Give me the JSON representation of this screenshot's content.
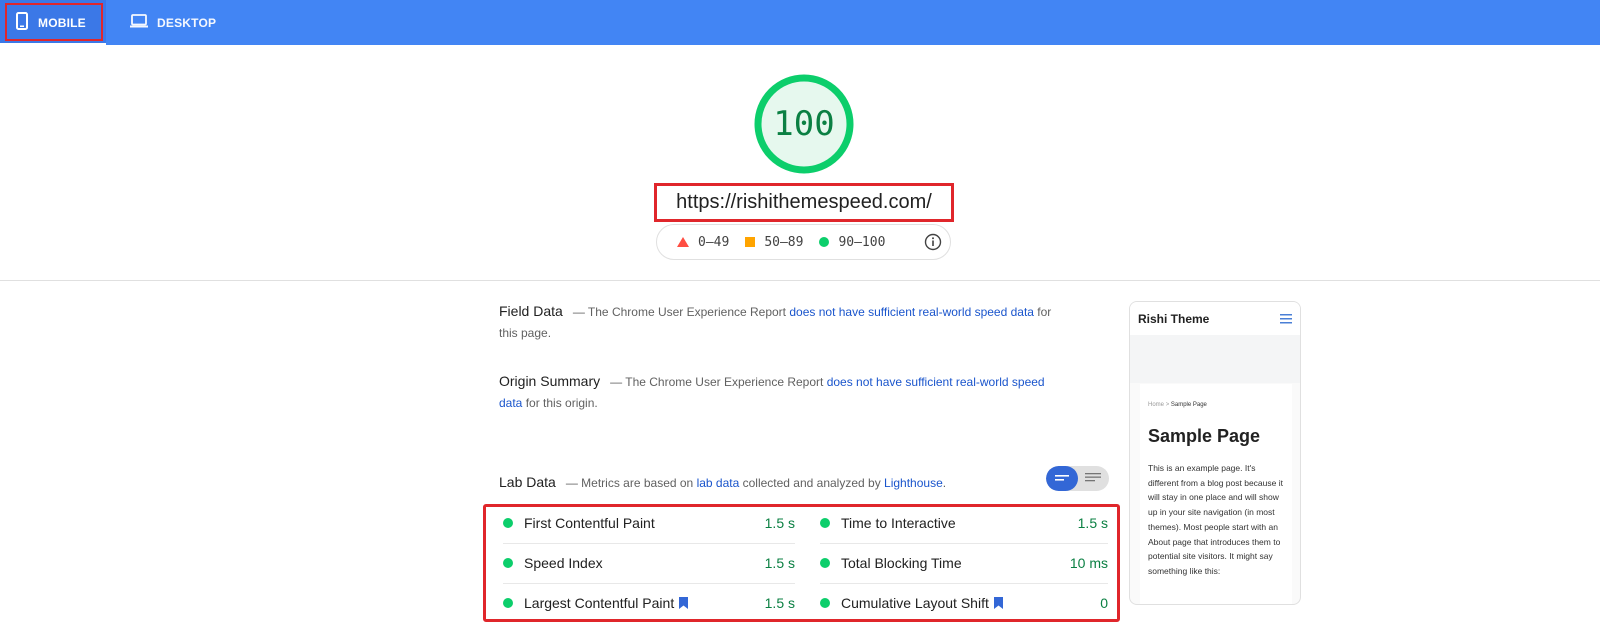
{
  "tabs": {
    "mobile": "MOBILE",
    "desktop": "DESKTOP"
  },
  "score": "100",
  "url": "https://rishithemespeed.com/",
  "legend": {
    "bad": "0–49",
    "average": "50–89",
    "good": "90–100"
  },
  "colors": {
    "good": "#0cce6b",
    "average": "#ffa400",
    "bad": "#ff4e42",
    "link": "#1a55cc",
    "topbar": "#4285f4"
  },
  "field_data": {
    "title": "Field Data",
    "prefix": "— The Chrome User Experience Report ",
    "link": "does not have sufficient real-world speed data",
    "suffix": " for this page."
  },
  "origin_summary": {
    "title": "Origin Summary",
    "prefix": "— The Chrome User Experience Report ",
    "link": "does not have sufficient real-world speed data",
    "suffix": " for this origin."
  },
  "lab_data": {
    "title": "Lab Data",
    "prefix": "— Metrics are based on ",
    "link1": "lab data",
    "middle": " collected and analyzed by ",
    "link2": "Lighthouse",
    "suffix": "."
  },
  "metrics": [
    {
      "label": "First Contentful Paint",
      "value": "1.5 s"
    },
    {
      "label": "Time to Interactive",
      "value": "1.5 s"
    },
    {
      "label": "Speed Index",
      "value": "1.5 s"
    },
    {
      "label": "Total Blocking Time",
      "value": "10 ms"
    },
    {
      "label": "Largest Contentful Paint",
      "value": "1.5 s"
    },
    {
      "label": "Cumulative Layout Shift",
      "value": "0"
    }
  ],
  "preview": {
    "site_title": "Rishi Theme",
    "breadcrumb_home": "Home",
    "breadcrumb_sep": ">",
    "breadcrumb_current": "Sample Page",
    "page_title": "Sample Page",
    "text": "This is an example page. It's different from a blog post because it will stay in one place and will show up in your site navigation (in most themes). Most people start with an About page that introduces them to potential site visitors. It might say something like this:"
  }
}
